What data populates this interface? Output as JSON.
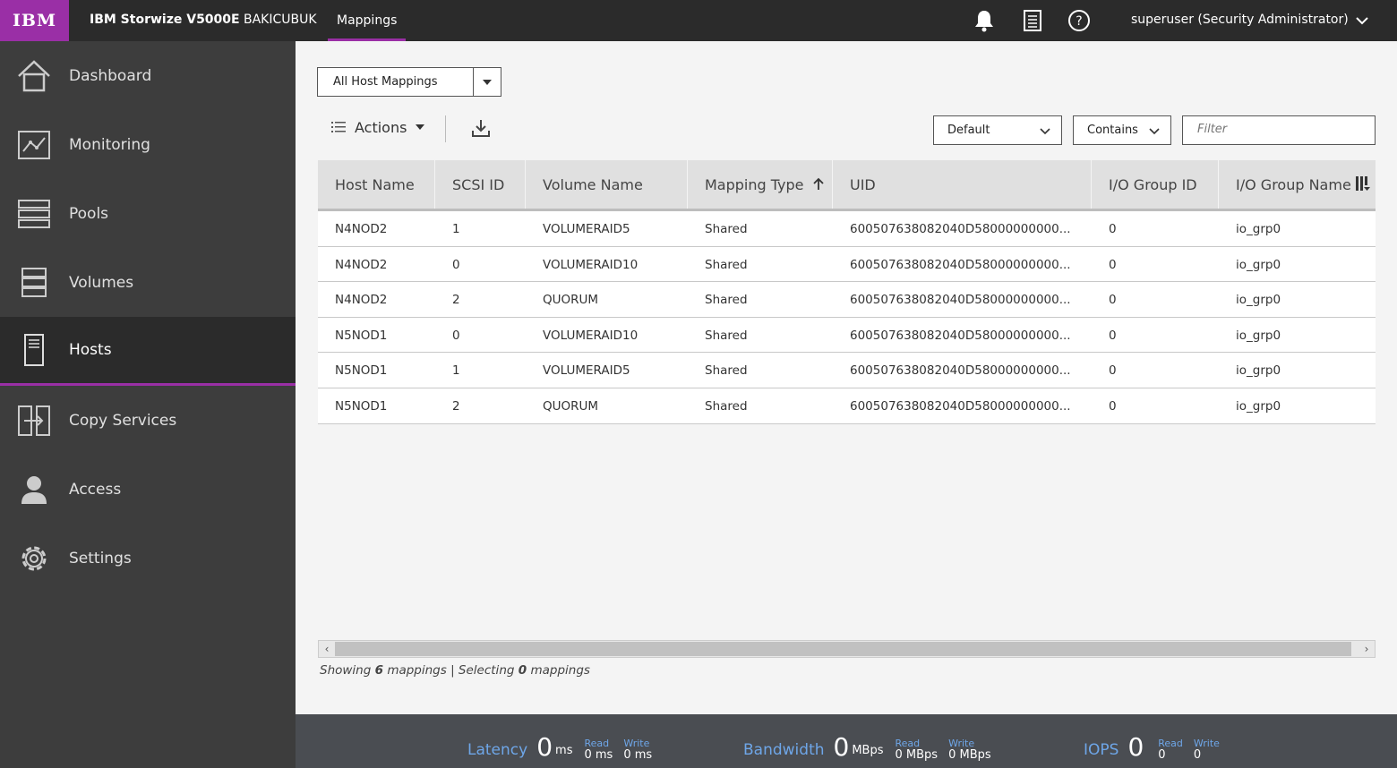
{
  "topbar": {
    "logo": "IBM",
    "product": "IBM Storwize V5000E",
    "system": "BAKICUBUK",
    "breadcrumb": "Mappings",
    "user": "superuser (Security Administrator)"
  },
  "sidebar": {
    "items": [
      {
        "label": "Dashboard",
        "icon": "home-icon"
      },
      {
        "label": "Monitoring",
        "icon": "monitoring-icon"
      },
      {
        "label": "Pools",
        "icon": "pools-icon"
      },
      {
        "label": "Volumes",
        "icon": "volumes-icon"
      },
      {
        "label": "Hosts",
        "icon": "hosts-icon",
        "active": true
      },
      {
        "label": "Copy Services",
        "icon": "copy-services-icon"
      },
      {
        "label": "Access",
        "icon": "access-icon"
      },
      {
        "label": "Settings",
        "icon": "gear-icon"
      }
    ]
  },
  "toolbar": {
    "view_select": "All Host Mappings",
    "actions_label": "Actions",
    "preset_select": "Default",
    "match_select": "Contains",
    "filter_placeholder": "Filter"
  },
  "table": {
    "headers": [
      "Host Name",
      "SCSI ID",
      "Volume Name",
      "Mapping Type",
      "UID",
      "I/O Group ID",
      "I/O Group Name"
    ],
    "rows": [
      [
        "N4NOD2",
        "1",
        "VOLUMERAID5",
        "Shared",
        "600507638082040D58000000000...",
        "0",
        "io_grp0"
      ],
      [
        "N4NOD2",
        "0",
        "VOLUMERAID10",
        "Shared",
        "600507638082040D58000000000...",
        "0",
        "io_grp0"
      ],
      [
        "N4NOD2",
        "2",
        "QUORUM",
        "Shared",
        "600507638082040D58000000000...",
        "0",
        "io_grp0"
      ],
      [
        "N5NOD1",
        "0",
        "VOLUMERAID10",
        "Shared",
        "600507638082040D58000000000...",
        "0",
        "io_grp0"
      ],
      [
        "N5NOD1",
        "1",
        "VOLUMERAID5",
        "Shared",
        "600507638082040D58000000000...",
        "0",
        "io_grp0"
      ],
      [
        "N5NOD1",
        "2",
        "QUORUM",
        "Shared",
        "600507638082040D58000000000...",
        "0",
        "io_grp0"
      ]
    ]
  },
  "status": {
    "showing_prefix": "Showing",
    "showing_count": "6",
    "mid": "mappings | Selecting",
    "selecting_count": "0",
    "suffix": "mappings"
  },
  "footer": {
    "latency": {
      "name": "Latency",
      "value": "0",
      "unit": "ms",
      "read_label": "Read",
      "read": "0 ms",
      "write_label": "Write",
      "write": "0 ms"
    },
    "bandwidth": {
      "name": "Bandwidth",
      "value": "0",
      "unit": "MBps",
      "read_label": "Read",
      "read": "0 MBps",
      "write_label": "Write",
      "write": "0 MBps"
    },
    "iops": {
      "name": "IOPS",
      "value": "0",
      "unit": "",
      "read_label": "Read",
      "read": "0",
      "write_label": "Write",
      "write": "0"
    }
  },
  "colors": {
    "accent": "#9a2fa6",
    "topbar": "#2b2b2b",
    "sidebar": "#3d3d3d",
    "metric_label": "#6ea6e8"
  }
}
